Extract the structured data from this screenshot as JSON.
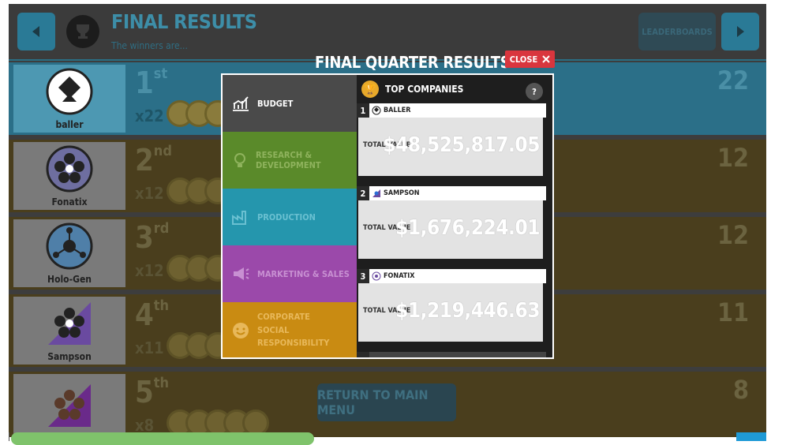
{
  "header": {
    "title": "FINAL RESULTS",
    "subtitle": "The winners are...",
    "leaderboards_label": "LEADERBOARDS"
  },
  "rows": [
    {
      "rank": "1",
      "suffix": "st",
      "company": "baller",
      "multiplier": "x22",
      "score": "22",
      "logo_icon": "spade-diamond-icon"
    },
    {
      "rank": "2",
      "suffix": "nd",
      "company": "Fonatix",
      "multiplier": "x12",
      "score": "12",
      "logo_icon": "flower-icon"
    },
    {
      "rank": "3",
      "suffix": "rd",
      "company": "Holo-Gen",
      "multiplier": "x12",
      "score": "12",
      "logo_icon": "molecule-icon"
    },
    {
      "rank": "4",
      "suffix": "th",
      "company": "Sampson",
      "multiplier": "x11",
      "score": "11",
      "logo_icon": "flower-triangle-icon"
    },
    {
      "rank": "5",
      "suffix": "th",
      "company": "",
      "multiplier": "x8",
      "score": "8",
      "logo_icon": "flower-triangle-icon"
    }
  ],
  "return_label": "RETURN TO MAIN MENU",
  "modal": {
    "title": "FINAL QUARTER RESULTS",
    "close_label": "CLOSE",
    "tabs": [
      {
        "label": "BUDGET",
        "icon": "chart-icon"
      },
      {
        "label": "RESEARCH & DEVELOPMENT",
        "icon": "lightbulb-icon"
      },
      {
        "label": "PRODUCTION",
        "icon": "factory-icon"
      },
      {
        "label": "MARKETING & SALES",
        "icon": "megaphone-icon"
      },
      {
        "label": "CORPORATE SOCIAL RESPONSIBILITY",
        "icon": "smiley-icon"
      }
    ],
    "panel_title": "TOP COMPANIES",
    "help_label": "?",
    "entries": [
      {
        "num": "1",
        "company": "BALLER",
        "label": "TOTAL VALUE",
        "value": "$48,525,817.05"
      },
      {
        "num": "2",
        "company": "SAMPSON",
        "label": "TOTAL VALUE",
        "value": "$1,676,224.01"
      },
      {
        "num": "3",
        "company": "FONATIX",
        "label": "TOTAL VALUE",
        "value": "$1,219,446.63"
      }
    ]
  },
  "colors": {
    "accent": "#2a7a96",
    "close": "#d9363e",
    "rd": "#5a8a2a",
    "production": "#2596ad",
    "marketing": "#9b49aa",
    "csr": "#c98b12"
  }
}
